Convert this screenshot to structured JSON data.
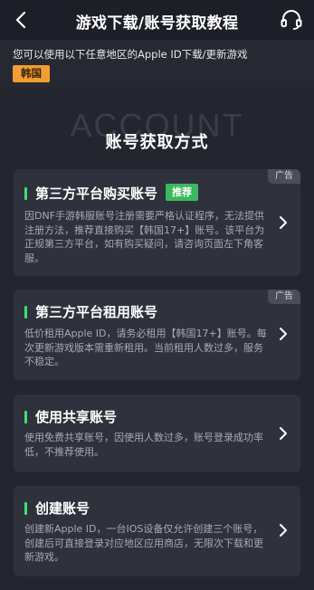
{
  "nav": {
    "title": "游戏下载/账号获取教程",
    "back_icon": "chevron-left-icon",
    "support_icon": "headset-icon"
  },
  "notice": {
    "text": "您可以使用以下任意地区的Apple ID下载/更新游戏",
    "region": "韩国"
  },
  "header": {
    "watermark": "ACCOUNT",
    "title": "账号获取方式"
  },
  "cards": [
    {
      "title": "第三方平台购买账号",
      "badge": "推荐",
      "ad": "广告",
      "description": "因DNF手游韩服账号注册需要严格认证程序，无法提供注册方法，推荐直接购买【韩国17+】账号。该平台为正规第三方平台，如有购买疑问，请咨询页面左下角客服。"
    },
    {
      "title": "第三方平台租用账号",
      "ad": "广告",
      "description": "低价租用Apple ID，请务必租用【韩国17+】账号。每次更新游戏版本需重新租用。当前租用人数过多，服务不稳定。"
    },
    {
      "title": "使用共享账号",
      "description": "使用免费共享账号，因使用人数过多，账号登录成功率低，不推荐使用。"
    },
    {
      "title": "创建账号",
      "description": "创建新Apple ID，一台IOS设备仅允许创建三个账号，创建后可直接登录对应地区应用商店，无限次下载和更新游戏。"
    }
  ],
  "colors": {
    "background": "#23252f",
    "card": "#2f313c",
    "accent_green": "#3ee06f",
    "region_orange": "#f29d33",
    "recommend_green": "#3ab85d"
  }
}
